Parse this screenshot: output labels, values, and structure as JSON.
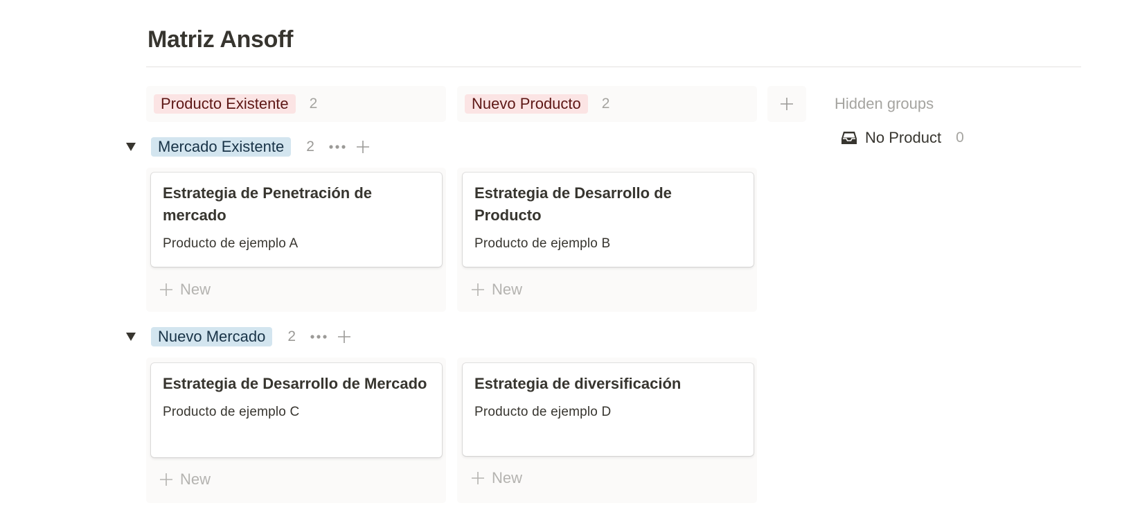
{
  "page": {
    "title": "Matriz Ansoff"
  },
  "columns": [
    {
      "label": "Producto Existente",
      "count": "2",
      "color": "#fbe4e4"
    },
    {
      "label": "Nuevo Producto",
      "count": "2",
      "color": "#fbe4e4"
    }
  ],
  "hidden_groups": {
    "title": "Hidden groups",
    "items": [
      {
        "label": "No Product",
        "count": "0",
        "icon": "inbox-icon"
      }
    ]
  },
  "groups": [
    {
      "label": "Mercado Existente",
      "count": "2",
      "color": "#d3e5ef",
      "cards": [
        {
          "title": "Estrategia de Penetración de mercado",
          "property": "Producto de ejemplo A"
        },
        {
          "title": "Estrategia de Desarrollo de Producto",
          "property": "Producto de ejemplo B"
        }
      ]
    },
    {
      "label": "Nuevo Mercado",
      "count": "2",
      "color": "#d3e5ef",
      "cards": [
        {
          "title": "Estrategia de Desarrollo de Mercado",
          "property": "Producto de ejemplo C"
        },
        {
          "title": "Estrategia de diversificación",
          "property": "Producto de ejemplo D"
        }
      ]
    }
  ],
  "new_label": "New"
}
